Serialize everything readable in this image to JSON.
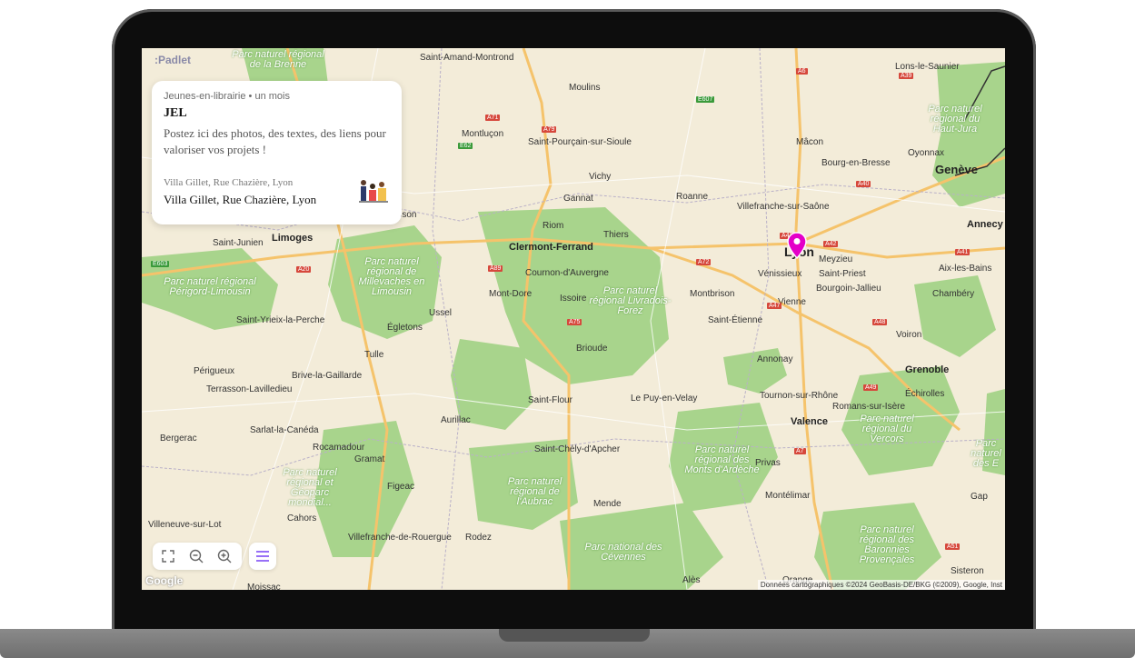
{
  "app": {
    "name": ":Padlet"
  },
  "card": {
    "meta": "Jeunes-en-librairie • un mois",
    "title": "JEL",
    "description": "Postez ici des photos, des textes, des liens pour valoriser vos projets !",
    "address_small": "Villa Gillet, Rue Chazière, Lyon",
    "address": "Villa Gillet, Rue Chazière, Lyon"
  },
  "map": {
    "attribution": "Données cartographiques ©2024 GeoBasis-DE/BKG (©2009), Google, Inst",
    "google_logo": "Google",
    "cities": [
      "Saint-Amand-Montrond",
      "Moulins",
      "Montluçon",
      "Saint-Pourçain-sur-Sioule",
      "Mâcon",
      "Bourg-en-Bresse",
      "Genève",
      "Vichy",
      "Gannat",
      "Roanne",
      "Villefranche-sur-Saône",
      "Riom",
      "Thiers",
      "Clermont-Ferrand",
      "Lyon",
      "Meyzieu",
      "Vénissieux",
      "Saint-Priest",
      "Aix-les-Bains",
      "Annecy",
      "Cournon-d'Auvergne",
      "Limoges",
      "Saint-Junien",
      "Aubusson",
      "Mont-Dore",
      "Issoire",
      "Montbrison",
      "Bourgoin-Jallieu",
      "Vienne",
      "Chambéry",
      "Ussel",
      "Égletons",
      "Saint-Yrieix-la-Perche",
      "Saint-Étienne",
      "Brioude",
      "Voiron",
      "Tulle",
      "Annonay",
      "Grenoble",
      "Périgueux",
      "Brive-la-Gaillarde",
      "Terrasson-Lavilledieu",
      "Saint-Flour",
      "Le Puy-en-Velay",
      "Tournon-sur-Rhône",
      "Échirolles",
      "Romans-sur-Isère",
      "Valence",
      "Aurillac",
      "Sarlat-la-Canéda",
      "Bergerac",
      "Rocamadour",
      "Gramat",
      "Saint-Chély-d'Apcher",
      "Privas",
      "Figeac",
      "Montélimar",
      "Cahors",
      "Mende",
      "Gap",
      "Villeneuve-sur-Lot",
      "Villefranche-de-Rouergue",
      "Rodez",
      "Alès",
      "Sisteron",
      "Moissac",
      "Oyonnax",
      "Lons-le-Saunier",
      "Orange"
    ],
    "parks": [
      "Parc naturel régional de la Brenne",
      "Parc naturel régional du Haut-Jura",
      "Parc naturel régional de Millevaches en Limousin",
      "Parc naturel régional Périgord-Limousin",
      "Parc naturel régional Livradois-Forez",
      "Parc naturel régional du Vercors",
      "Parc naturel régional et Géoparc mondial...",
      "Parc naturel régional des Monts d'Ardèche",
      "Parc naturel régional de l'Aubrac",
      "Parc national des Cévennes",
      "Parc naturel régional des Baronnies Provençales",
      "Parc naturel des E"
    ],
    "roads": [
      "A71",
      "A79",
      "E607",
      "A6",
      "A39",
      "E62",
      "A40",
      "A41",
      "A42",
      "A43",
      "A72",
      "A47",
      "A48",
      "A49",
      "A7",
      "A89",
      "A20",
      "A75",
      "A51",
      "E603"
    ],
    "pin_location": "Lyon"
  },
  "controls": {
    "fullscreen": "fullscreen-icon",
    "zoom_out": "zoom-out-icon",
    "zoom_in": "zoom-in-icon",
    "list": "list-icon"
  },
  "colors": {
    "pin": "#e400c8",
    "park": "#a8d48c",
    "land": "#f3ecd9",
    "road": "#f5c36b"
  }
}
